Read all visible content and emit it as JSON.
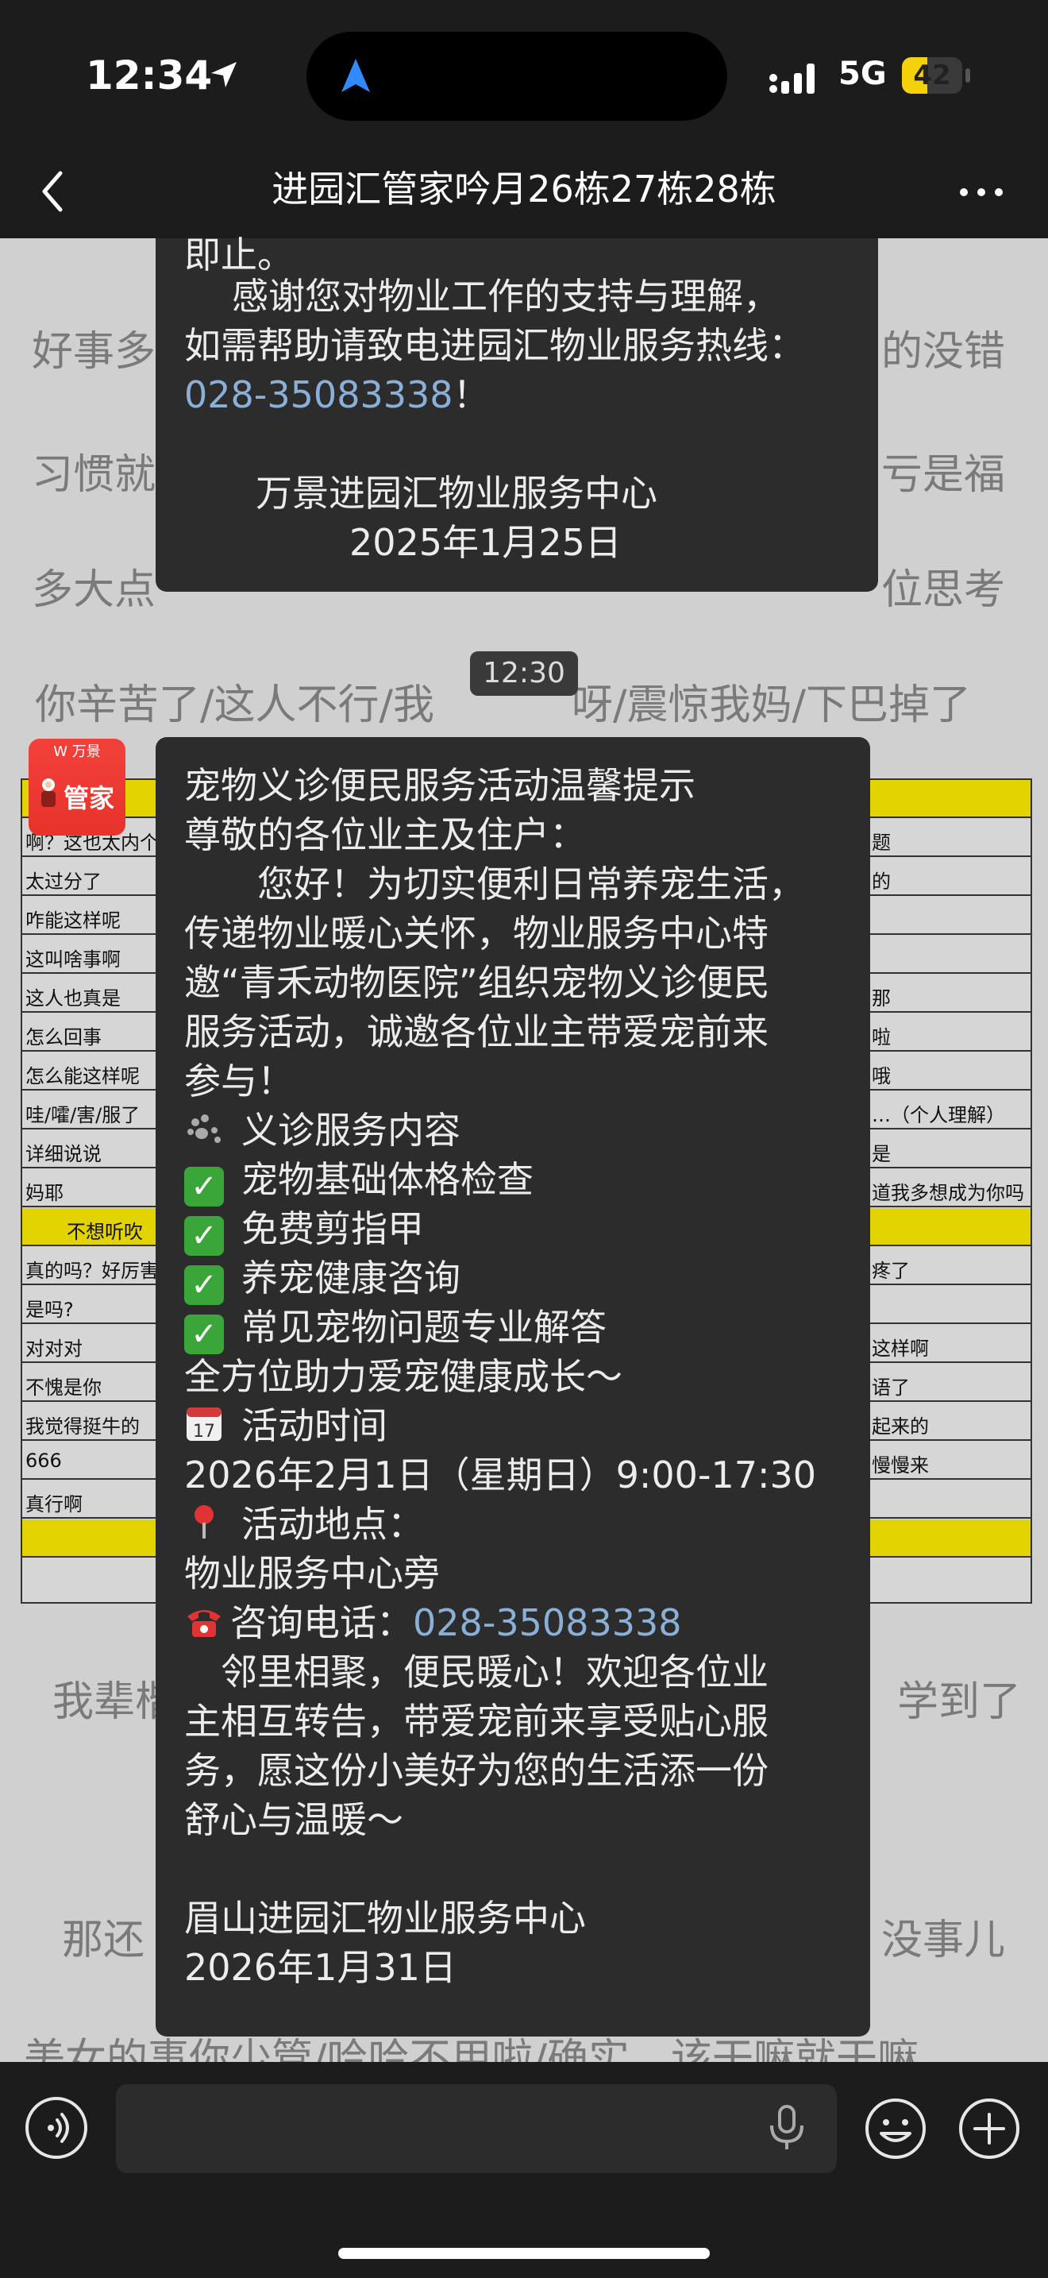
{
  "status": {
    "time": "12:34",
    "network": "5G",
    "battery": "42",
    "battery_level": 0.42
  },
  "nav": {
    "title": "进园汇管家吟月26栋27栋28栋"
  },
  "wallpaper": [
    "好事多",
    "的没错",
    "习惯就",
    "亏是福",
    "多大点",
    "位思考",
    "你辛苦了/这人不行/我",
    "呀/震惊我妈/下巴掉了",
    "我辈楷",
    "学到了",
    "那还",
    "没事儿",
    "美女的事你少管/哈哈不用啦/确实，该干嘛就干嘛"
  ],
  "sheet": {
    "left": [
      "啊？这也太内个",
      "太过分了",
      "咋能这样呢",
      "这叫啥事啊",
      "这人也真是",
      "怎么回事",
      "怎么能这样呢",
      "哇/嚯/害/服了",
      "详细说说",
      "妈耶",
      "不想听吹",
      "真的吗？好厉害",
      "是吗?",
      "对对对",
      "不愧是你",
      "我觉得挺牛的",
      "666",
      "真行啊"
    ],
    "right": [
      "题",
      "的",
      "那",
      "啦",
      "哦",
      "…（个人理解）",
      "是",
      "道我多想成为你吗",
      "疼了",
      "这样啊",
      "语了",
      "起来的",
      "慢慢来"
    ]
  },
  "messages": {
    "top": {
      "lines": [
        "即止。",
        "感谢您对物业工作的支持与理解，",
        "如需帮助请致电进园汇物业服务热线："
      ],
      "phone": "028-35083338",
      "phone_suffix": "！",
      "sign1": "万景进园汇物业服务中心",
      "sign2": "2025年1月25日"
    },
    "timestamp": "12:30",
    "avatar": {
      "top": "W 万景",
      "label": "管家"
    },
    "main": {
      "title": "宠物义诊便民服务活动温馨提示",
      "greeting": " 尊敬的各位业主及住户：",
      "para": [
        "　　您好！为切实便利日常养宠生活，",
        "传递物业暖心关怀，物业服务中心特",
        "邀“青禾动物医院”组织宠物义诊便民",
        "服务活动，诚邀各位业主带爱宠前来",
        "参与！"
      ],
      "section1": "义诊服务内容",
      "items": [
        "宠物基础体格检查",
        "免费剪指甲",
        "养宠健康咨询",
        "常见宠物问题专业解答"
      ],
      "summary": "全方位助力爱宠健康成长～",
      "time_label": "活动时间",
      "time_value": "2026年2月1日（星期日）9:00-17:30",
      "place_label": "活动地点：",
      "place_value": "物业服务中心旁",
      "phone_label": "咨询电话：",
      "phone": "028-35083338",
      "closing": [
        "　邻里相聚，便民暖心！欢迎各位业",
        "主相互转告，带爱宠前来享受贴心服",
        "务，愿这份小美好为您的生活添一份",
        "舒心与温暖～"
      ],
      "sign1": "眉山进园汇物业服务中心",
      "sign2": "2026年1月31日",
      "calendar_icon_text": "17"
    }
  },
  "colors": {
    "bubble": "#2c2c2c",
    "link": "#8ab0d8",
    "bar": "#1c1c1c",
    "check": "#3aa63a",
    "avatar": "#e8322c"
  }
}
